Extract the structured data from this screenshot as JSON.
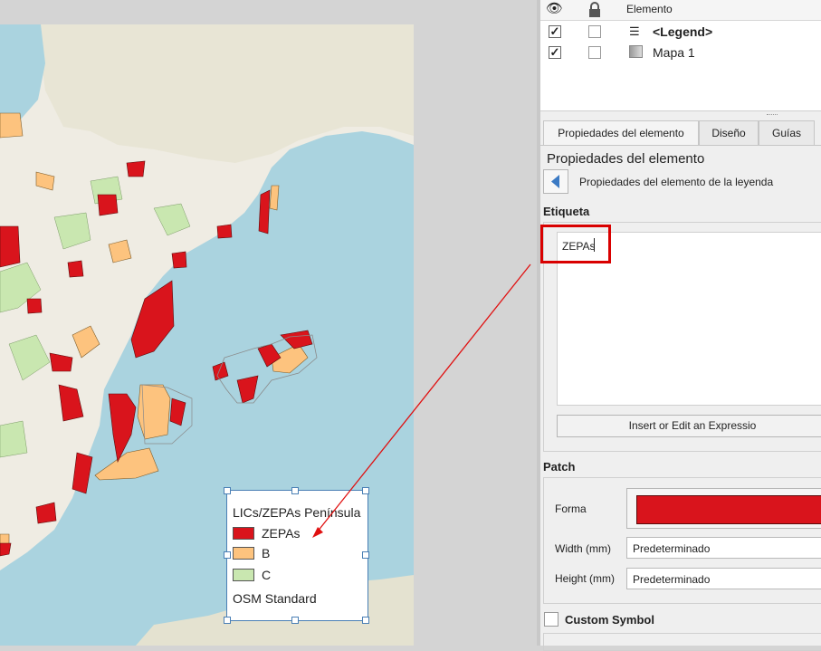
{
  "colors": {
    "zepas": "#d9141c",
    "b": "#fdc37e",
    "c": "#c9e7b0",
    "sea": "#aad3df",
    "land": "#efece3",
    "selection": "#d90000"
  },
  "legend": {
    "title": "LICs/ZEPAs Península",
    "items": [
      {
        "label": "ZEPAs",
        "swatch": "#d9141c"
      },
      {
        "label": "B",
        "swatch": "#fdc37e"
      },
      {
        "label": "C",
        "swatch": "#c9e7b0"
      }
    ],
    "footer": "OSM Standard"
  },
  "layers_panel": {
    "columns": {
      "visibility_icon": "eye-icon",
      "lock_icon": "lock-icon",
      "element": "Elemento"
    },
    "rows": [
      {
        "label": "<Legend>",
        "visible": "✓",
        "bold": true,
        "icon": "legend-icon"
      },
      {
        "label": "Mapa 1",
        "visible": "✓",
        "bold": false,
        "icon": "map-icon"
      }
    ]
  },
  "tabs": [
    "Propiedades del elemento",
    "Diseño",
    "Guías"
  ],
  "properties": {
    "header": "Propiedades del elemento",
    "subheader": "Propiedades del elemento de la leyenda",
    "label_section": "Etiqueta",
    "label_text": "ZEPAs",
    "expression_button": "Insert or Edit an Expressio",
    "patch_section": "Patch",
    "forma_label": "Forma",
    "width_label": "Width (mm)",
    "width_value": "Predeterminado",
    "height_label": "Height (mm)",
    "height_value": "Predeterminado",
    "custom_symbol": "Custom Symbol"
  }
}
